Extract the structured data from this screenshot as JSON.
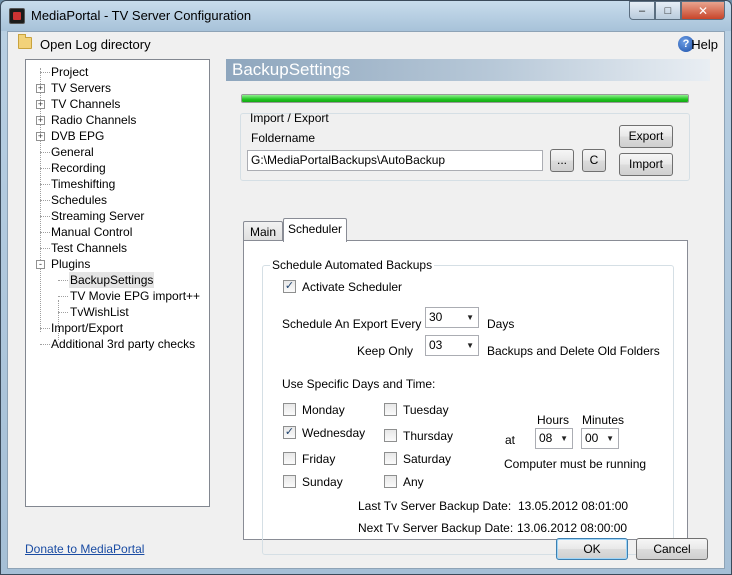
{
  "window": {
    "title": "MediaPortal - TV Server Configuration"
  },
  "title_buttons": {
    "minimize": "–",
    "maximize": "□",
    "close": "✕"
  },
  "toolbar": {
    "open_log": "Open Log directory",
    "help": "Help",
    "help_glyph": "?"
  },
  "tree": {
    "items": [
      {
        "label": "Project",
        "level": 0,
        "expander": ""
      },
      {
        "label": "TV Servers",
        "level": 0,
        "expander": "+"
      },
      {
        "label": "TV Channels",
        "level": 0,
        "expander": "+"
      },
      {
        "label": "Radio Channels",
        "level": 0,
        "expander": "+"
      },
      {
        "label": "DVB EPG",
        "level": 0,
        "expander": "+"
      },
      {
        "label": "General",
        "level": 0,
        "expander": ""
      },
      {
        "label": "Recording",
        "level": 0,
        "expander": ""
      },
      {
        "label": "Timeshifting",
        "level": 0,
        "expander": ""
      },
      {
        "label": "Schedules",
        "level": 0,
        "expander": ""
      },
      {
        "label": "Streaming Server",
        "level": 0,
        "expander": ""
      },
      {
        "label": "Manual Control",
        "level": 0,
        "expander": ""
      },
      {
        "label": "Test Channels",
        "level": 0,
        "expander": ""
      },
      {
        "label": "Plugins",
        "level": 0,
        "expander": "-"
      },
      {
        "label": "BackupSettings",
        "level": 1,
        "expander": "",
        "selected": true
      },
      {
        "label": "TV Movie EPG import++",
        "level": 1,
        "expander": ""
      },
      {
        "label": "TvWishList",
        "level": 1,
        "expander": ""
      },
      {
        "label": "Import/Export",
        "level": 0,
        "expander": ""
      },
      {
        "label": "Additional 3rd party checks",
        "level": 0,
        "expander": ""
      }
    ]
  },
  "panel": {
    "header": "BackupSettings",
    "progress": 1.0,
    "import_export": {
      "group_label": "Import / Export",
      "foldername_label": "Foldername",
      "foldername_value": "G:\\MediaPortalBackups\\AutoBackup",
      "browse_label": "...",
      "c_label": "C",
      "export_label": "Export",
      "import_label": "Import"
    },
    "tabs": [
      {
        "label": "Main"
      },
      {
        "label": "Scheduler"
      }
    ],
    "scheduler": {
      "group_label": "Schedule Automated Backups",
      "activate_label": "Activate Scheduler",
      "activate_checked": "✓",
      "export_every_label": "Schedule An Export Every",
      "export_every_value": "30",
      "days_label": "Days",
      "keep_only_label": "Keep Only",
      "keep_only_value": "03",
      "backups_label": "Backups and Delete Old Folders",
      "specific_label": "Use Specific Days and Time:",
      "days": [
        {
          "label": "Monday",
          "mark": ""
        },
        {
          "label": "Tuesday",
          "mark": ""
        },
        {
          "label": "Wednesday",
          "mark": "✓"
        },
        {
          "label": "Thursday",
          "mark": ""
        },
        {
          "label": "Friday",
          "mark": ""
        },
        {
          "label": "Saturday",
          "mark": ""
        },
        {
          "label": "Sunday",
          "mark": ""
        },
        {
          "label": "Any",
          "mark": ""
        }
      ],
      "hours_label": "Hours",
      "minutes_label": "Minutes",
      "at_label": "at",
      "hours_value": "08",
      "minutes_value": "00",
      "running_label": "Computer must be running",
      "last_label": "Last Tv Server Backup Date:",
      "last_value": "13.05.2012 08:01:00",
      "next_label": "Next Tv Server Backup Date:",
      "next_value": "13.06.2012 08:00:00"
    }
  },
  "footer": {
    "donate": "Donate to MediaPortal",
    "ok": "OK",
    "cancel": "Cancel"
  }
}
